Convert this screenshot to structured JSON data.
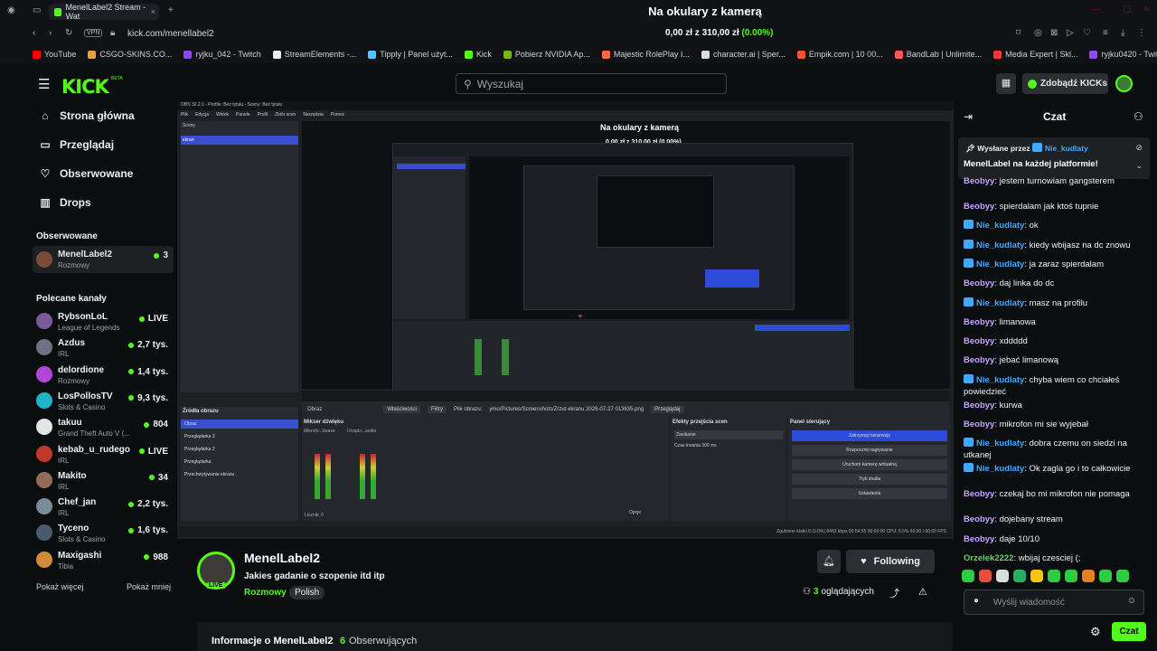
{
  "browser": {
    "tab_title": "MenelLabel2 Stream - Wat",
    "url": "kick.com/menellabel2",
    "vpn": "VPN",
    "bookmarks": [
      "YouTube",
      "CSGO-SKINS.CO...",
      "ryjku_042 - Twitch",
      "StreamElements -...",
      "Tipply | Panel użyt...",
      "Kick",
      "Pobierz NVIDIA Ap...",
      "Majestic RolePlay I...",
      "character.ai | Sper...",
      "Empik.com | 10 00...",
      "BandLab | Unlimite...",
      "Media Expert | Skl...",
      "ryjku0420 - Twitch"
    ]
  },
  "overlay": {
    "title": "Na okulary z kamerą",
    "goal": "0,00 zł z 310,00 zł (0.00%)",
    "goal_highlight": "(0.00%)"
  },
  "header": {
    "logo": "KICK",
    "beta": "BETA",
    "search_placeholder": "Wyszukaj",
    "get_kicks": "Zdobądź KICKs"
  },
  "nav": [
    {
      "label": "Strona główna",
      "icon": "home-icon"
    },
    {
      "label": "Przeglądaj",
      "icon": "browse-icon"
    },
    {
      "label": "Obserwowane",
      "icon": "heart-icon"
    },
    {
      "label": "Drops",
      "icon": "drops-icon"
    }
  ],
  "following_section": {
    "title": "Obserwowane",
    "channel": {
      "name": "MenelLabel2",
      "category": "Rozmowy",
      "viewers": "3"
    }
  },
  "recommended_section": {
    "title": "Polecane kanały",
    "channels": [
      {
        "name": "RybsonLoL",
        "category": "League of Legends",
        "viewers": "LIVE",
        "color": "#7b5a9b"
      },
      {
        "name": "Azdus",
        "category": "IRL",
        "viewers": "2,7 tys.",
        "color": "#6b7280"
      },
      {
        "name": "delordione",
        "category": "Rozmowy",
        "viewers": "1,4 tys.",
        "color": "#b146d9"
      },
      {
        "name": "LosPollosTV",
        "category": "Slots & Casino",
        "viewers": "9,3 tys.",
        "color": "#1fb3c9"
      },
      {
        "name": "takuu",
        "category": "Grand Theft Auto V (...",
        "viewers": "804",
        "color": "#e5e5e5"
      },
      {
        "name": "kebab_u_rudego",
        "category": "IRL",
        "viewers": "LIVE",
        "color": "#c0392b"
      },
      {
        "name": "Makito",
        "category": "IRL",
        "viewers": "34",
        "color": "#8f6d5a"
      },
      {
        "name": "Chef_jan",
        "category": "IRL",
        "viewers": "2,2 tys.",
        "color": "#7a8c99"
      },
      {
        "name": "Tyceno",
        "category": "Slots & Casino",
        "viewers": "1,6 tys.",
        "color": "#4a5a6a"
      },
      {
        "name": "Maxigashi",
        "category": "Tibia",
        "viewers": "988",
        "color": "#d08a3a"
      }
    ],
    "more": "Pokaż więcej",
    "less": "Pokaż mniej"
  },
  "stream_obs": {
    "window_title": "OBS 32.2.1 - Profile: Bez tytułu - Sceny: Bez tytułu",
    "menu": [
      "Plik",
      "Edycja",
      "Widok",
      "Panele",
      "Profil",
      "Zbiór scen",
      "Narzędzia",
      "Pomoc"
    ],
    "scenes_label": "Sceny",
    "scene_item": "ekran",
    "source_label": "Obraz",
    "props": "Właściwości",
    "filters": "Filtry",
    "file_label": "Plik obrazu:",
    "file_path": "ymo/Pictures/Screenshots/Zrzut ekranu 2026-07-27 013635.png",
    "browse": "Przeglądaj",
    "sources_title": "Źródła obrazu",
    "sources": [
      "Obraz",
      "Przeglądarka 3",
      "Przeglądarka 2",
      "Przeglądarka",
      "Przechwytywanie ekranu"
    ],
    "mixer_title": "Mikser dźwięku",
    "mixer_ch": [
      "Globalne",
      "Globalne"
    ],
    "mixer_names": [
      "Mikrofo...i/wave",
      "Urządz...audio"
    ],
    "transitions_title": "Efekty przejścia scen",
    "transition": "Zanikanie",
    "duration_label": "Czas trwania",
    "duration": "300 ms",
    "controls_title": "Panel sterujący",
    "controls": [
      "Zatrzymaj transmisję",
      "Rozpocznij nagrywanie",
      "Uruchom kamerę wirtualną",
      "Tryb studia",
      "Ustawienia"
    ],
    "status": "Zgubione klatki 0 (0.0%)   8482 kbps   00:54:55   00:00:00   CPU: 5.5%   60.00 / 60.00 FPS",
    "options": "Opcje",
    "counter": "Licznik: 0"
  },
  "channel": {
    "name": "MenelLabel2",
    "title": "Jakies gadanie o szopenie itd itp",
    "category": "Rozmowy",
    "language": "Polish",
    "live": "LIVE",
    "follow": "Following",
    "viewers_count": "3",
    "viewers_label": "oglądających",
    "about": "Informacje o MenelLabel2",
    "followers_count": "6",
    "followers_label": "Obserwujących"
  },
  "chat": {
    "title": "Czat",
    "pinned_by": "Wysłane przez",
    "pinned_user": "Nie_kudlaty",
    "pinned_text": "MenelLabel na każdej platformie!",
    "messages": [
      {
        "user": "Beobyy",
        "text": "jestem turnowiam gangsterem",
        "type": "b"
      },
      {
        "user": "Beobyy",
        "text": "spierdalam jak ktoś tupnie",
        "type": "b"
      },
      {
        "user": "Nie_kudlaty",
        "text": "ok",
        "type": "n"
      },
      {
        "user": "Nie_kudlaty",
        "text": "kiedy wbijasz na dc znowu",
        "type": "n"
      },
      {
        "user": "Nie_kudlaty",
        "text": "ja zaraz spierdalam",
        "type": "n"
      },
      {
        "user": "Beobyy",
        "text": "daj linka do dc",
        "type": "b"
      },
      {
        "user": "Nie_kudlaty",
        "text": "masz na profilu",
        "type": "n"
      },
      {
        "user": "Beobyy",
        "text": "limanowa",
        "type": "b"
      },
      {
        "user": "Beobyy",
        "text": "xddddd",
        "type": "b"
      },
      {
        "user": "Beobyy",
        "text": "jebać limanową",
        "type": "b"
      },
      {
        "user": "Nie_kudlaty",
        "text": "chyba wiem co chciałeś powiedzieć",
        "type": "n"
      },
      {
        "user": "Beobyy",
        "text": "kurwa",
        "type": "b"
      },
      {
        "user": "Beobyy",
        "text": "mikrofon mi sie wyjebał",
        "type": "b"
      },
      {
        "user": "Nie_kudlaty",
        "text": "dobra czemu on siedzi na utkanej",
        "type": "n"
      },
      {
        "user": "Nie_kudlaty",
        "text": "Ok zagla go i to całkowicie",
        "type": "n"
      },
      {
        "user": "Beobyy",
        "text": "czekaj bo mi mikrofon nie pomaga",
        "type": "b"
      },
      {
        "user": "Beobyy",
        "text": "dojebany stream",
        "type": "b"
      },
      {
        "user": "Beobyy",
        "text": "daje 10/10",
        "type": "b"
      },
      {
        "user": "Orzelek2222",
        "text": "wbijaj czesciej (;",
        "type": "o"
      }
    ],
    "input_placeholder": "Wyślij wiadomość",
    "send": "Czat"
  }
}
